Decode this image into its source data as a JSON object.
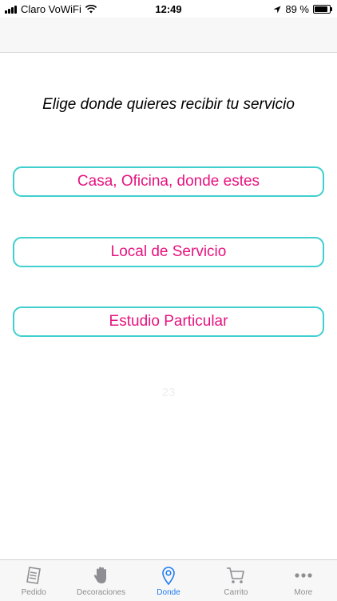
{
  "status_bar": {
    "carrier": "Claro VoWiFi",
    "time": "12:49",
    "battery": "89 %"
  },
  "main": {
    "heading": "Elige donde quieres recibir tu servicio",
    "options": [
      {
        "label": "Casa, Oficina, donde estes"
      },
      {
        "label": "Local de Servicio"
      },
      {
        "label": "Estudio Particular"
      }
    ],
    "faint_number": "23"
  },
  "colors": {
    "accent_text": "#e6137f",
    "button_border": "#3fcfcf",
    "tab_active": "#1e7cf2",
    "tab_inactive": "#8e8e93"
  },
  "tab_bar": {
    "tabs": [
      {
        "label": "Pedido",
        "icon": "receipt-icon",
        "active": false
      },
      {
        "label": "Decoraciones",
        "icon": "hand-icon",
        "active": false
      },
      {
        "label": "Donde",
        "icon": "location-pin-icon",
        "active": true
      },
      {
        "label": "Carrito",
        "icon": "cart-icon",
        "active": false
      },
      {
        "label": "More",
        "icon": "more-dots-icon",
        "active": false
      }
    ]
  }
}
